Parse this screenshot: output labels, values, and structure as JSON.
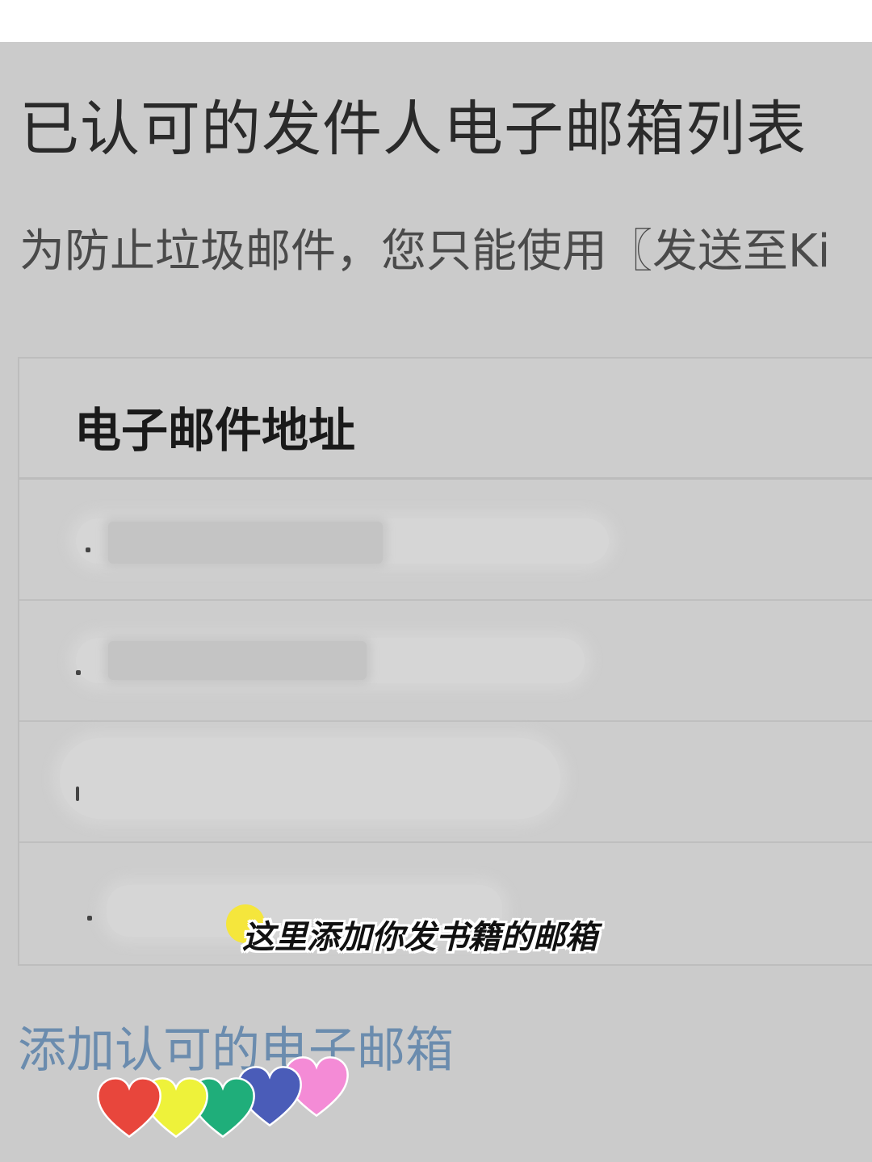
{
  "page": {
    "title": "已认可的发件人电子邮箱列表",
    "description": "为防止垃圾邮件，您只能使用〖发送至Ki"
  },
  "table": {
    "column_header": "电子邮件地址",
    "rows": [
      "",
      "",
      "",
      ""
    ]
  },
  "add_link": "添加认可的电子邮箱",
  "annotation": {
    "text": "这里添加你发书籍的邮箱",
    "dot_color": "#f5e63c"
  },
  "decoration": {
    "hearts": [
      "#e8463c",
      "#eef23a",
      "#1fae7a",
      "#4a5cb8",
      "#f48bd6"
    ]
  },
  "colors": {
    "background": "#cbcbcb",
    "link": "#6b8cae"
  }
}
